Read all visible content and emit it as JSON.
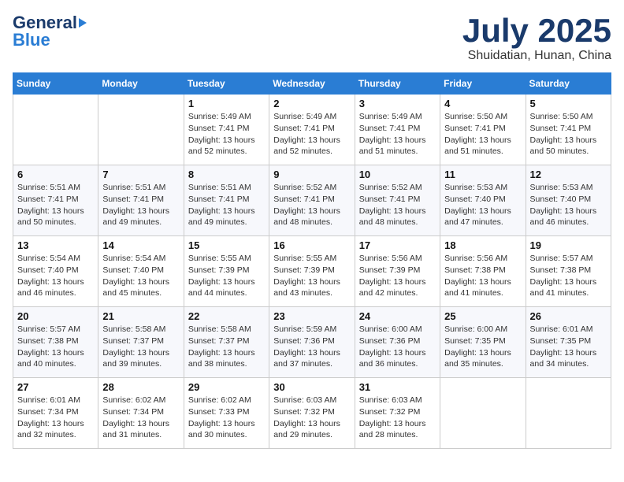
{
  "header": {
    "logo_general": "General",
    "logo_blue": "Blue",
    "title": "July 2025",
    "location": "Shuidatian, Hunan, China"
  },
  "weekdays": [
    "Sunday",
    "Monday",
    "Tuesday",
    "Wednesday",
    "Thursday",
    "Friday",
    "Saturday"
  ],
  "weeks": [
    [
      {
        "day": "",
        "info": ""
      },
      {
        "day": "",
        "info": ""
      },
      {
        "day": "1",
        "info": "Sunrise: 5:49 AM\nSunset: 7:41 PM\nDaylight: 13 hours and 52 minutes."
      },
      {
        "day": "2",
        "info": "Sunrise: 5:49 AM\nSunset: 7:41 PM\nDaylight: 13 hours and 52 minutes."
      },
      {
        "day": "3",
        "info": "Sunrise: 5:49 AM\nSunset: 7:41 PM\nDaylight: 13 hours and 51 minutes."
      },
      {
        "day": "4",
        "info": "Sunrise: 5:50 AM\nSunset: 7:41 PM\nDaylight: 13 hours and 51 minutes."
      },
      {
        "day": "5",
        "info": "Sunrise: 5:50 AM\nSunset: 7:41 PM\nDaylight: 13 hours and 50 minutes."
      }
    ],
    [
      {
        "day": "6",
        "info": "Sunrise: 5:51 AM\nSunset: 7:41 PM\nDaylight: 13 hours and 50 minutes."
      },
      {
        "day": "7",
        "info": "Sunrise: 5:51 AM\nSunset: 7:41 PM\nDaylight: 13 hours and 49 minutes."
      },
      {
        "day": "8",
        "info": "Sunrise: 5:51 AM\nSunset: 7:41 PM\nDaylight: 13 hours and 49 minutes."
      },
      {
        "day": "9",
        "info": "Sunrise: 5:52 AM\nSunset: 7:41 PM\nDaylight: 13 hours and 48 minutes."
      },
      {
        "day": "10",
        "info": "Sunrise: 5:52 AM\nSunset: 7:41 PM\nDaylight: 13 hours and 48 minutes."
      },
      {
        "day": "11",
        "info": "Sunrise: 5:53 AM\nSunset: 7:40 PM\nDaylight: 13 hours and 47 minutes."
      },
      {
        "day": "12",
        "info": "Sunrise: 5:53 AM\nSunset: 7:40 PM\nDaylight: 13 hours and 46 minutes."
      }
    ],
    [
      {
        "day": "13",
        "info": "Sunrise: 5:54 AM\nSunset: 7:40 PM\nDaylight: 13 hours and 46 minutes."
      },
      {
        "day": "14",
        "info": "Sunrise: 5:54 AM\nSunset: 7:40 PM\nDaylight: 13 hours and 45 minutes."
      },
      {
        "day": "15",
        "info": "Sunrise: 5:55 AM\nSunset: 7:39 PM\nDaylight: 13 hours and 44 minutes."
      },
      {
        "day": "16",
        "info": "Sunrise: 5:55 AM\nSunset: 7:39 PM\nDaylight: 13 hours and 43 minutes."
      },
      {
        "day": "17",
        "info": "Sunrise: 5:56 AM\nSunset: 7:39 PM\nDaylight: 13 hours and 42 minutes."
      },
      {
        "day": "18",
        "info": "Sunrise: 5:56 AM\nSunset: 7:38 PM\nDaylight: 13 hours and 41 minutes."
      },
      {
        "day": "19",
        "info": "Sunrise: 5:57 AM\nSunset: 7:38 PM\nDaylight: 13 hours and 41 minutes."
      }
    ],
    [
      {
        "day": "20",
        "info": "Sunrise: 5:57 AM\nSunset: 7:38 PM\nDaylight: 13 hours and 40 minutes."
      },
      {
        "day": "21",
        "info": "Sunrise: 5:58 AM\nSunset: 7:37 PM\nDaylight: 13 hours and 39 minutes."
      },
      {
        "day": "22",
        "info": "Sunrise: 5:58 AM\nSunset: 7:37 PM\nDaylight: 13 hours and 38 minutes."
      },
      {
        "day": "23",
        "info": "Sunrise: 5:59 AM\nSunset: 7:36 PM\nDaylight: 13 hours and 37 minutes."
      },
      {
        "day": "24",
        "info": "Sunrise: 6:00 AM\nSunset: 7:36 PM\nDaylight: 13 hours and 36 minutes."
      },
      {
        "day": "25",
        "info": "Sunrise: 6:00 AM\nSunset: 7:35 PM\nDaylight: 13 hours and 35 minutes."
      },
      {
        "day": "26",
        "info": "Sunrise: 6:01 AM\nSunset: 7:35 PM\nDaylight: 13 hours and 34 minutes."
      }
    ],
    [
      {
        "day": "27",
        "info": "Sunrise: 6:01 AM\nSunset: 7:34 PM\nDaylight: 13 hours and 32 minutes."
      },
      {
        "day": "28",
        "info": "Sunrise: 6:02 AM\nSunset: 7:34 PM\nDaylight: 13 hours and 31 minutes."
      },
      {
        "day": "29",
        "info": "Sunrise: 6:02 AM\nSunset: 7:33 PM\nDaylight: 13 hours and 30 minutes."
      },
      {
        "day": "30",
        "info": "Sunrise: 6:03 AM\nSunset: 7:32 PM\nDaylight: 13 hours and 29 minutes."
      },
      {
        "day": "31",
        "info": "Sunrise: 6:03 AM\nSunset: 7:32 PM\nDaylight: 13 hours and 28 minutes."
      },
      {
        "day": "",
        "info": ""
      },
      {
        "day": "",
        "info": ""
      }
    ]
  ]
}
